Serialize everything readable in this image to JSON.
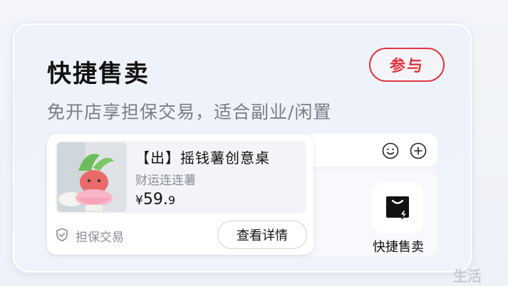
{
  "card": {
    "title": "快捷售卖",
    "join_label": "参与",
    "subtitle": "免开店享担保交易，适合副业/闲置"
  },
  "product": {
    "title": "【出】摇钱薯创意桌",
    "subtitle": "财运连连薯",
    "price_symbol": "¥",
    "price_int": "59.",
    "price_dec": "9",
    "guarantee_label": "担保交易",
    "detail_button": "查看详情"
  },
  "side": {
    "quick_sell_label": "快捷售卖"
  },
  "icons": {
    "smile": "smile-icon",
    "plus": "plus-icon",
    "bag": "shopping-bag-icon",
    "shield": "shield-check-icon"
  },
  "colors": {
    "accent": "#e0353f",
    "text": "#111111",
    "muted": "#7a7d85"
  },
  "watermark": "生活"
}
